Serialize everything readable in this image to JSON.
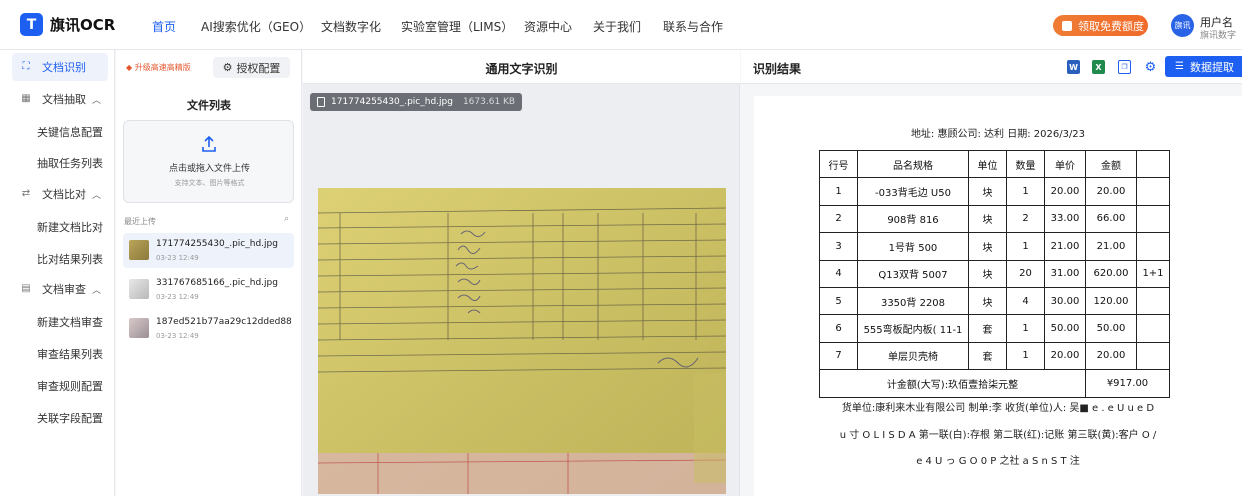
{
  "app": {
    "logo_letter": "T",
    "name": "旗讯OCR"
  },
  "nav": [
    "首页",
    "AI搜索优化（GEO）",
    "文档数字化",
    "实验室管理（LIMS）",
    "资源中心",
    "关于我们",
    "联系与合作"
  ],
  "promo": "领取免费额度",
  "user": {
    "avatar": "旗讯",
    "name": "用户名",
    "org": "旗讯数字"
  },
  "sidebar": {
    "ocr": "文档识别",
    "extract": {
      "label": "文档抽取",
      "items": [
        "关键信息配置",
        "抽取任务列表"
      ]
    },
    "compare": {
      "label": "文档比对",
      "items": [
        "新建文档比对",
        "比对结果列表"
      ]
    },
    "review": {
      "label": "文档审查",
      "items": [
        "新建文档审查",
        "审查结果列表",
        "审查规则配置",
        "关联字段配置"
      ]
    }
  },
  "filepanel": {
    "upgrade": "升级高速高精版",
    "auth": "授权配置",
    "title": "文件列表",
    "upload_main": "点击或拖入文件上传",
    "upload_sub": "支持文本、图片等格式",
    "recent": "最近上传",
    "files": [
      {
        "name": "171774255430_.pic_hd.jpg",
        "time": "03-23 12:49"
      },
      {
        "name": "331767685166_.pic_hd.jpg",
        "time": "03-23 12:49"
      },
      {
        "name": "187ed521b77aa29c12dded88...",
        "time": "03-23 12:49"
      }
    ]
  },
  "center": {
    "title": "通用文字识别",
    "file_name": "171774255430_.pic_hd.jpg",
    "file_size": "1673.61 KB"
  },
  "right": {
    "title": "识别结果",
    "extract_btn": "数据提取",
    "address": "地址: 惠顾公司: 达利 日期: 2026/3/23",
    "headers": [
      "行号",
      "品名规格",
      "单位",
      "数量",
      "单价",
      "金额",
      ""
    ],
    "rows": [
      [
        "1",
        "-033背毛边 U50",
        "块",
        "1",
        "20.00",
        "20.00",
        ""
      ],
      [
        "2",
        "908背 816",
        "块",
        "2",
        "33.00",
        "66.00",
        ""
      ],
      [
        "3",
        "1号背 500",
        "块",
        "1",
        "21.00",
        "21.00",
        ""
      ],
      [
        "4",
        "Q13双背 5007",
        "块",
        "20",
        "31.00",
        "620.00",
        "1+1"
      ],
      [
        "5",
        "3350背 2208",
        "块",
        "4",
        "30.00",
        "120.00",
        ""
      ],
      [
        "6",
        "555弯板配内板( 11-1",
        "套",
        "1",
        "50.00",
        "50.00",
        ""
      ],
      [
        "7",
        "单层贝壳椅",
        "套",
        "1",
        "20.00",
        "20.00",
        ""
      ]
    ],
    "total_label": "计金额(大写):玖佰壹拾柒元整",
    "total_value": "¥917.00",
    "footer": [
      "货单位:康利来木业有限公司 制单:李 收货(单位)人: 吴■ e . e U u e D",
      "u 寸 O L I S D A 第一联(白):存根 第二联(红):记账 第三联(黄):客户 O /",
      "e 4 U っ G O 0 P 之社 a S n S T 注"
    ]
  },
  "colors": {
    "accent": "#1d5ff0",
    "promo": "#f06a2a",
    "paper": "#d3c766"
  }
}
